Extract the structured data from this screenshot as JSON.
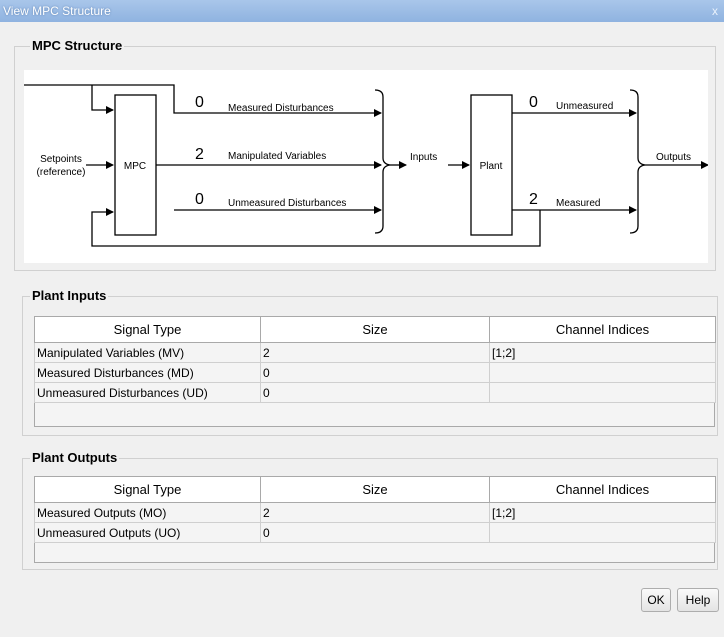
{
  "window": {
    "title": "View MPC Structure",
    "close": "x"
  },
  "structure": {
    "group_label": "MPC Structure",
    "diagram": {
      "setpoints_line1": "Setpoints",
      "setpoints_line2": "(reference)",
      "mpc_label": "MPC",
      "md_count": "0",
      "md_label": "Measured Disturbances",
      "mv_count": "2",
      "mv_label": "Manipulated Variables",
      "ud_count": "0",
      "ud_label": "Unmeasured Disturbances",
      "inputs_label": "Inputs",
      "plant_label": "Plant",
      "uo_count": "0",
      "uo_label": "Unmeasured",
      "mo_count": "2",
      "mo_label": "Measured",
      "outputs_label": "Outputs"
    }
  },
  "plant_inputs": {
    "group_label": "Plant Inputs",
    "headers": [
      "Signal Type",
      "Size",
      "Channel Indices"
    ],
    "rows": [
      [
        "Manipulated Variables (MV)",
        "2",
        "[1;2]"
      ],
      [
        "Measured Disturbances (MD)",
        "0",
        ""
      ],
      [
        "Unmeasured Disturbances (UD)",
        "0",
        ""
      ]
    ]
  },
  "plant_outputs": {
    "group_label": "Plant Outputs",
    "headers": [
      "Signal Type",
      "Size",
      "Channel Indices"
    ],
    "rows": [
      [
        "Measured Outputs (MO)",
        "2",
        "[1;2]"
      ],
      [
        "Unmeasured Outputs (UO)",
        "0",
        ""
      ]
    ]
  },
  "buttons": {
    "ok": "OK",
    "help": "Help"
  }
}
